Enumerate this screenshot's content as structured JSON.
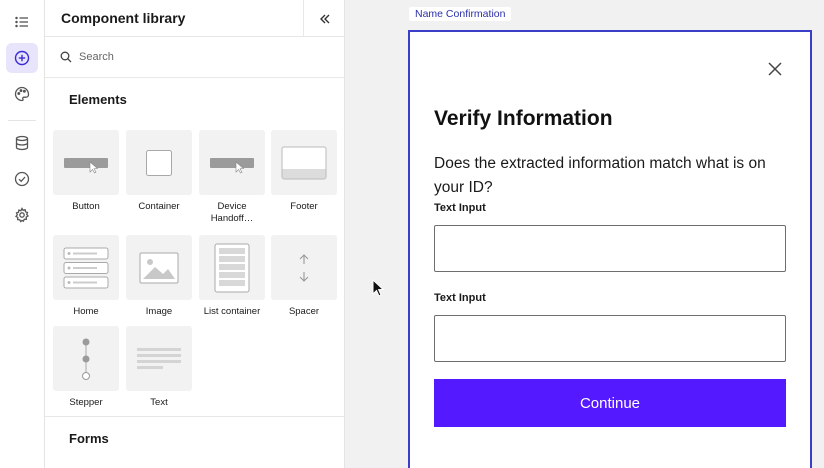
{
  "colors": {
    "accent": "#5419ff",
    "frame_border": "#3b3fc7",
    "active_rail": "#e7e4fb"
  },
  "rail": {
    "items": [
      {
        "icon": "list-icon"
      },
      {
        "icon": "add-circle-icon",
        "active": true
      },
      {
        "icon": "palette-icon"
      },
      {
        "icon": "database-icon"
      },
      {
        "icon": "check-circle-icon"
      },
      {
        "icon": "gear-icon"
      }
    ]
  },
  "library": {
    "title": "Component library",
    "search_placeholder": "Search",
    "elements_title": "Elements",
    "elements": [
      {
        "label": "Button",
        "icon": "button-thumbnail"
      },
      {
        "label": "Container",
        "icon": "container-thumbnail"
      },
      {
        "label": "Device Handoff…",
        "icon": "device-handoff-thumbnail"
      },
      {
        "label": "Footer",
        "icon": "footer-thumbnail"
      },
      {
        "label": "Home",
        "icon": "home-thumbnail"
      },
      {
        "label": "Image",
        "icon": "image-thumbnail"
      },
      {
        "label": "List container",
        "icon": "list-container-thumbnail"
      },
      {
        "label": "Spacer",
        "icon": "spacer-thumbnail"
      },
      {
        "label": "Stepper",
        "icon": "stepper-thumbnail"
      },
      {
        "label": "Text",
        "icon": "text-thumbnail"
      }
    ],
    "forms_title": "Forms"
  },
  "canvas": {
    "frame_name": "Name Confirmation",
    "screen": {
      "heading": "Verify Information",
      "question": "Does the extracted information match what is on your ID?",
      "fields": [
        {
          "label": "Text Input",
          "value": ""
        },
        {
          "label": "Text Input",
          "value": ""
        }
      ],
      "continue_label": "Continue"
    }
  }
}
